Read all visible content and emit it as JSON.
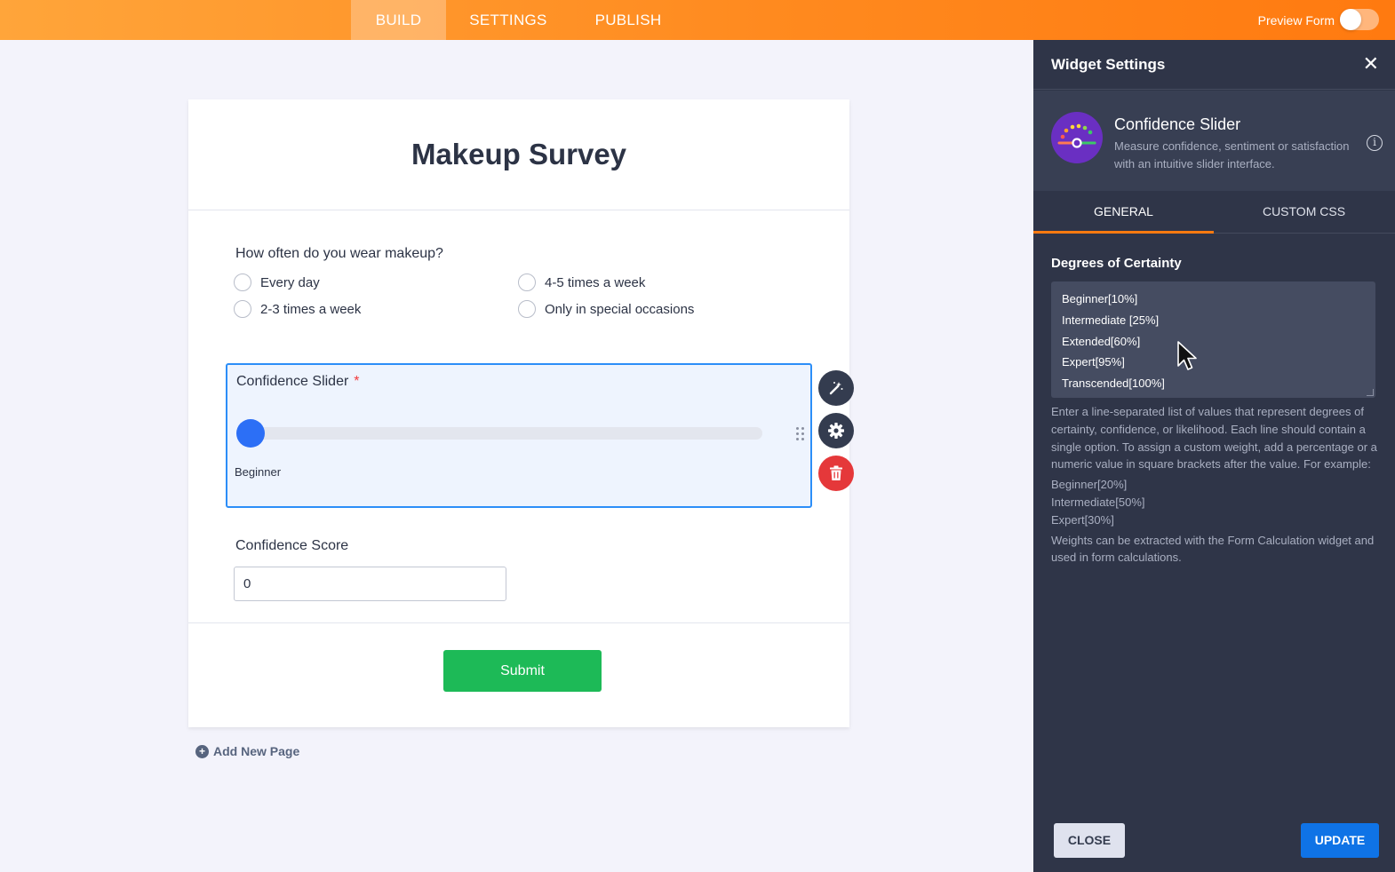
{
  "topbar": {
    "tabs": [
      {
        "label": "BUILD",
        "active": true
      },
      {
        "label": "SETTINGS",
        "active": false
      },
      {
        "label": "PUBLISH",
        "active": false
      }
    ],
    "preview_label": "Preview Form",
    "preview_on": false
  },
  "form": {
    "title": "Makeup Survey",
    "question1": {
      "label": "How often do you wear makeup?",
      "options": [
        "Every day",
        "4-5 times a week",
        "2-3 times a week",
        "Only in special occasions"
      ]
    },
    "slider": {
      "label": "Confidence Slider",
      "required_mark": "*",
      "value_label": "Beginner",
      "position_fraction": 0
    },
    "score": {
      "label": "Confidence Score",
      "value": "0"
    },
    "submit_label": "Submit",
    "add_page_label": "Add New Page"
  },
  "panel": {
    "title": "Widget Settings",
    "close_x": "✕",
    "widget_name": "Confidence Slider",
    "widget_desc": "Measure confidence, sentiment or satisfaction with an intuitive slider interface.",
    "info_icon": "i",
    "tabs": [
      {
        "label": "GENERAL",
        "active": true
      },
      {
        "label": "CUSTOM CSS",
        "active": false
      }
    ],
    "field_label": "Degrees of Certainty",
    "degrees": [
      "Beginner[10%]",
      "Intermediate [25%]",
      "Extended[60%]",
      "Expert[95%]",
      "Transcended[100%]"
    ],
    "help_text": "Enter a line-separated list of values that represent degrees of certainty, confidence, or likelihood. Each line should contain a single option. To assign a custom weight, add a percentage or a numeric value in square brackets after the value. For example:",
    "help_examples": [
      "Beginner[20%]",
      "Intermediate[50%]",
      "Expert[30%]"
    ],
    "help_footer": "Weights can be extracted with the Form Calculation widget and used in form calculations.",
    "close_label": "CLOSE",
    "update_label": "UPDATE"
  },
  "colors": {
    "accent_orange": "#ff7a10",
    "slider_blue": "#2c6ff6",
    "submit_green": "#1dba57",
    "delete_red": "#e5383a",
    "update_blue": "#0f73e6",
    "panel_bg": "#2f3548"
  },
  "icons": {
    "magic_wand": "magic-wand-icon",
    "settings": "gear-icon",
    "delete": "trash-icon",
    "close": "close-icon",
    "info": "info-icon",
    "add": "plus-circle-icon",
    "drag": "drag-handle-icon"
  }
}
